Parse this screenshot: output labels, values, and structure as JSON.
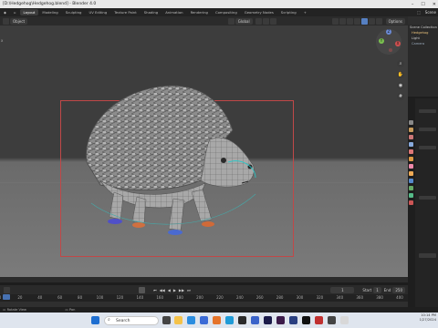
{
  "window": {
    "title": "[D:\\Hedgehog\\Hedgehog.blend] - Blender 4.0",
    "controls": [
      "–",
      "☐",
      "✕"
    ]
  },
  "workspaces": {
    "tabs": [
      "Layout",
      "Modeling",
      "Sculpting",
      "UV Editing",
      "Texture Paint",
      "Shading",
      "Animation",
      "Rendering",
      "Compositing",
      "Geometry Nodes",
      "Scripting",
      "+"
    ],
    "active": "Layout",
    "scene_label": "Scene"
  },
  "viewport_header": {
    "mode": "Object",
    "transform": "Global",
    "options": "Options",
    "overlay_label": "x"
  },
  "viewport": {
    "colors": {
      "camera_border": "#c04848",
      "background": "#3d3d3d",
      "floor": "#7b7b7b"
    }
  },
  "gizmo": {
    "x": "X",
    "y": "Y",
    "z": "Z"
  },
  "outliner": {
    "items": [
      "Scene Collection",
      "Hedgehog",
      "Light",
      "Camera"
    ]
  },
  "timeline": {
    "ruler_ticks": [
      "0",
      "20",
      "40",
      "60",
      "80",
      "100",
      "120",
      "140",
      "160",
      "180",
      "200",
      "220",
      "240",
      "260",
      "280",
      "300",
      "320",
      "340",
      "360",
      "380",
      "400",
      "420",
      "440",
      "460"
    ],
    "start_label": "Start",
    "start_value": "1",
    "end_label": "End",
    "end_value": "250",
    "current_frame": "1"
  },
  "status_bar": {
    "left": "Rotate View",
    "middle": "Pan"
  },
  "taskbar": {
    "search_placeholder": "Search",
    "time": "10:14 PM",
    "date": "1/27/2024"
  }
}
